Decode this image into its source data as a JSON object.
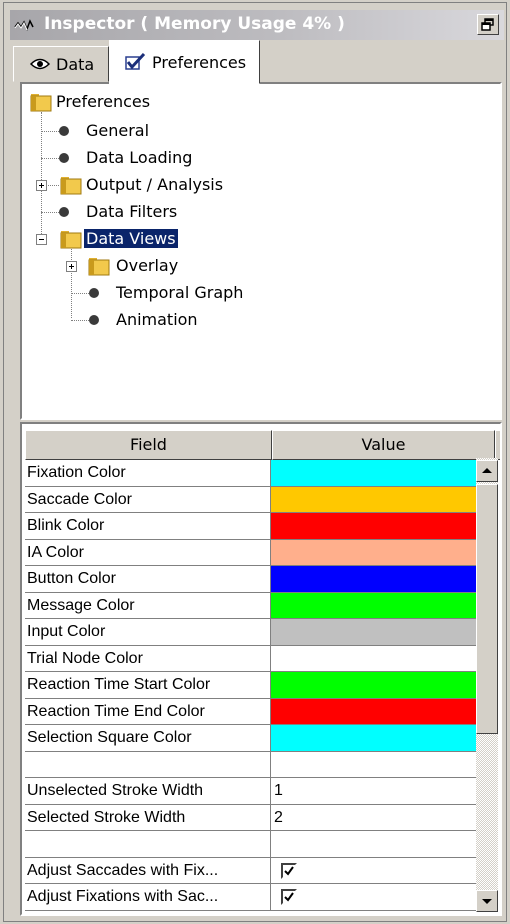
{
  "window": {
    "title": "Inspector ( Memory Usage 4% )"
  },
  "tabs": [
    {
      "label": "Data",
      "icon": "eye-icon"
    },
    {
      "label": "Preferences",
      "icon": "checkbox-icon",
      "selected": true
    }
  ],
  "tree": {
    "root": "Preferences",
    "items": [
      {
        "label": "General"
      },
      {
        "label": "Data Loading"
      },
      {
        "label": "Output / Analysis"
      },
      {
        "label": "Data Filters"
      },
      {
        "label": "Data Views",
        "selected": true
      },
      {
        "label": "Overlay"
      },
      {
        "label": "Temporal Graph"
      },
      {
        "label": "Animation"
      }
    ]
  },
  "table": {
    "columns": [
      "Field",
      "Value"
    ],
    "rows": [
      {
        "field": "Fixation Color",
        "color": "#00ffff"
      },
      {
        "field": "Saccade Color",
        "color": "#ffc800"
      },
      {
        "field": "Blink Color",
        "color": "#ff0000"
      },
      {
        "field": "IA Color",
        "color": "#ffaf8c"
      },
      {
        "field": "Button Color",
        "color": "#0000ff"
      },
      {
        "field": "Message Color",
        "color": "#00ff00"
      },
      {
        "field": "Input Color",
        "color": "#c0c0c0"
      },
      {
        "field": "Trial Node Color",
        "color": "#ffffff"
      },
      {
        "field": "Reaction Time Start Color",
        "color": "#00ff00"
      },
      {
        "field": "Reaction Time End Color",
        "color": "#ff0000"
      },
      {
        "field": "Selection Square Color",
        "color": "#00ffff"
      },
      {
        "field": "",
        "value": ""
      },
      {
        "field": "Unselected Stroke Width",
        "value": "1"
      },
      {
        "field": "Selected Stroke Width",
        "value": "2"
      },
      {
        "field": "",
        "value": ""
      },
      {
        "field": "Adjust Saccades with Fix...",
        "checked": true
      },
      {
        "field": "Adjust Fixations with Sac...",
        "checked": true
      }
    ]
  }
}
